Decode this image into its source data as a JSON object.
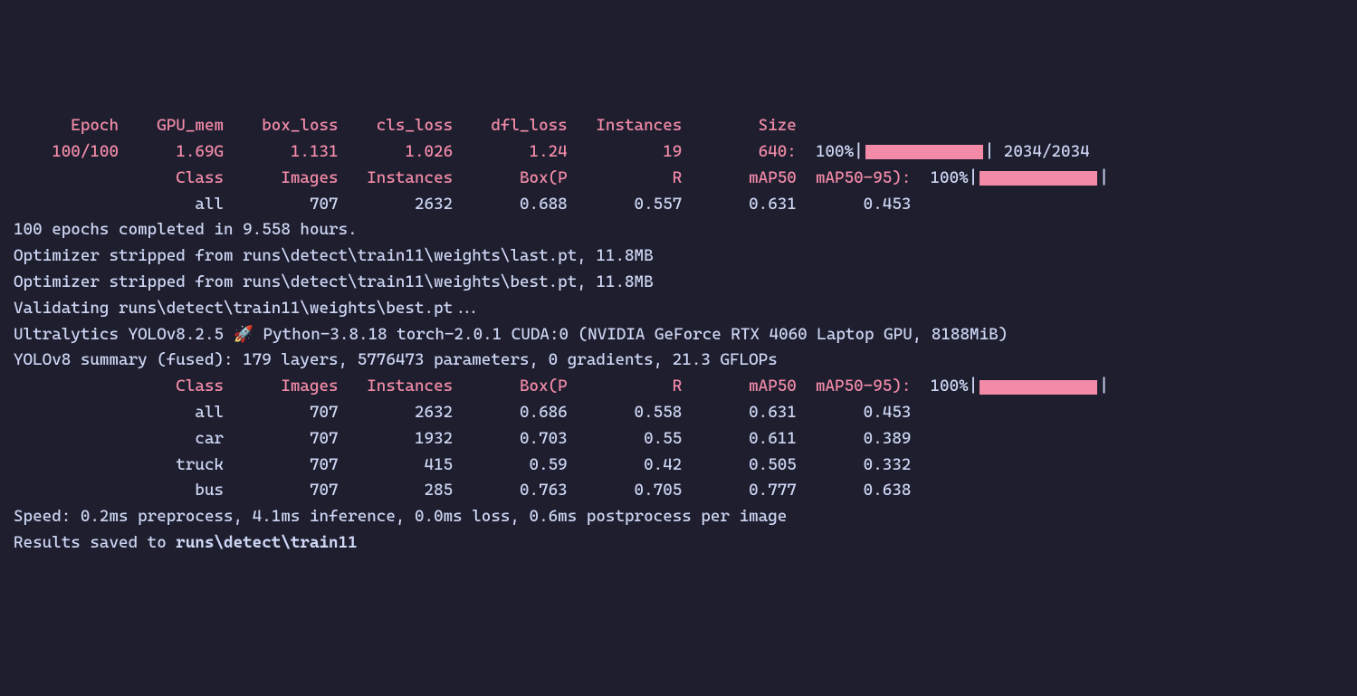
{
  "train_header": {
    "cols": [
      "Epoch",
      "GPU_mem",
      "box_loss",
      "cls_loss",
      "dfl_loss",
      "Instances",
      "Size"
    ]
  },
  "train_row": {
    "epoch": "100/100",
    "gpu_mem": "1.69G",
    "box_loss": "1.131",
    "cls_loss": "1.026",
    "dfl_loss": "1.24",
    "instances": "19",
    "size": "640:",
    "pct": "100%",
    "count": "2034/2034"
  },
  "val1_header": {
    "cols": [
      "Class",
      "Images",
      "Instances",
      "Box(P",
      "R",
      "mAP50",
      "mAP50-95):"
    ],
    "pct": "100%"
  },
  "val1_rows": [
    {
      "class": "all",
      "images": "707",
      "instances": "2632",
      "boxp": "0.688",
      "r": "0.557",
      "map50": "0.631",
      "map5095": "0.453"
    }
  ],
  "completion": "100 epochs completed in 9.558 hours.",
  "opt_last": "Optimizer stripped from runs\\detect\\train11\\weights\\last.pt, 11.8MB",
  "opt_best": "Optimizer stripped from runs\\detect\\train11\\weights\\best.pt, 11.8MB",
  "validating": "Validating runs\\detect\\train11\\weights\\best.pt...",
  "ultralytics_pre": "Ultralytics YOLOv8.2.5 ",
  "ultralytics_post": " Python-3.8.18 torch-2.0.1 CUDA:0 (NVIDIA GeForce RTX 4060 Laptop GPU, 8188MiB)",
  "summary": "YOLOv8 summary (fused): 179 layers, 5776473 parameters, 0 gradients, 21.3 GFLOPs",
  "val2_header": {
    "cols": [
      "Class",
      "Images",
      "Instances",
      "Box(P",
      "R",
      "mAP50",
      "mAP50-95):"
    ],
    "pct": "100%"
  },
  "val2_rows": [
    {
      "class": "all",
      "images": "707",
      "instances": "2632",
      "boxp": "0.686",
      "r": "0.558",
      "map50": "0.631",
      "map5095": "0.453"
    },
    {
      "class": "car",
      "images": "707",
      "instances": "1932",
      "boxp": "0.703",
      "r": "0.55",
      "map50": "0.611",
      "map5095": "0.389"
    },
    {
      "class": "truck",
      "images": "707",
      "instances": "415",
      "boxp": "0.59",
      "r": "0.42",
      "map50": "0.505",
      "map5095": "0.332"
    },
    {
      "class": "bus",
      "images": "707",
      "instances": "285",
      "boxp": "0.763",
      "r": "0.705",
      "map50": "0.777",
      "map5095": "0.638"
    }
  ],
  "speed": "Speed: 0.2ms preprocess, 4.1ms inference, 0.0ms loss, 0.6ms postprocess per image",
  "results_prefix": "Results saved to ",
  "results_path": "runs\\detect\\train11"
}
